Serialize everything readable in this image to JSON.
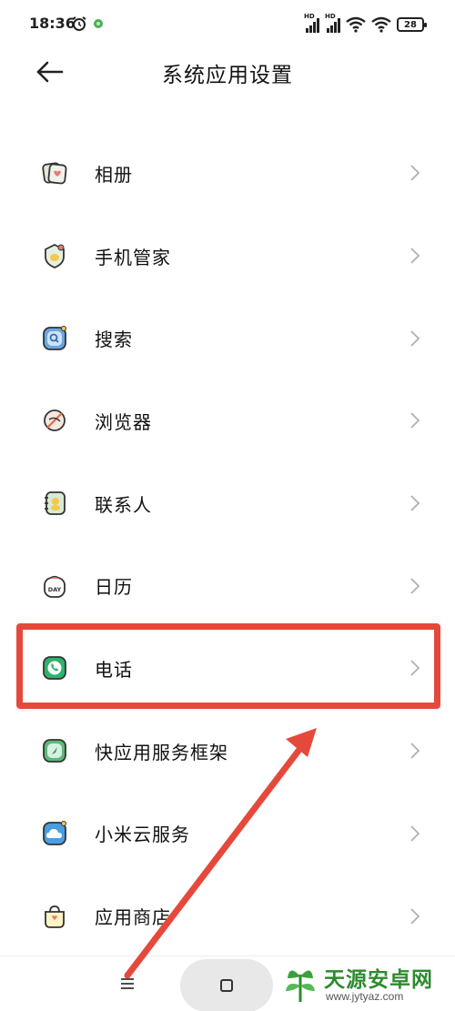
{
  "status_bar": {
    "time": "18:36",
    "battery": "28",
    "icons": [
      "alarm-icon",
      "app-notification-icon",
      "hd-signal-icon",
      "hd-signal-icon",
      "wifi-icon",
      "wifi-icon",
      "battery-icon"
    ]
  },
  "header": {
    "title": "系统应用设置",
    "back_icon": "back-arrow-icon"
  },
  "items": [
    {
      "label": "相册",
      "icon": "gallery-icon"
    },
    {
      "label": "手机管家",
      "icon": "security-icon"
    },
    {
      "label": "搜索",
      "icon": "search-app-icon"
    },
    {
      "label": "浏览器",
      "icon": "browser-icon"
    },
    {
      "label": "联系人",
      "icon": "contacts-icon"
    },
    {
      "label": "日历",
      "icon": "calendar-icon"
    },
    {
      "label": "电话",
      "icon": "phone-icon"
    },
    {
      "label": "快应用服务框架",
      "icon": "quick-apps-icon"
    },
    {
      "label": "小米云服务",
      "icon": "cloud-icon"
    },
    {
      "label": "应用商店",
      "icon": "app-store-icon"
    }
  ],
  "calendar_icon_text": "DAY",
  "annotation": {
    "highlight_color": "#e5493b",
    "highlighted_item": "电话"
  },
  "watermark": {
    "name": "天源安卓网",
    "url": "www.jytyaz.com"
  },
  "colors": {
    "accent_green": "#2e8b2e",
    "annotation_red": "#e5493b"
  }
}
